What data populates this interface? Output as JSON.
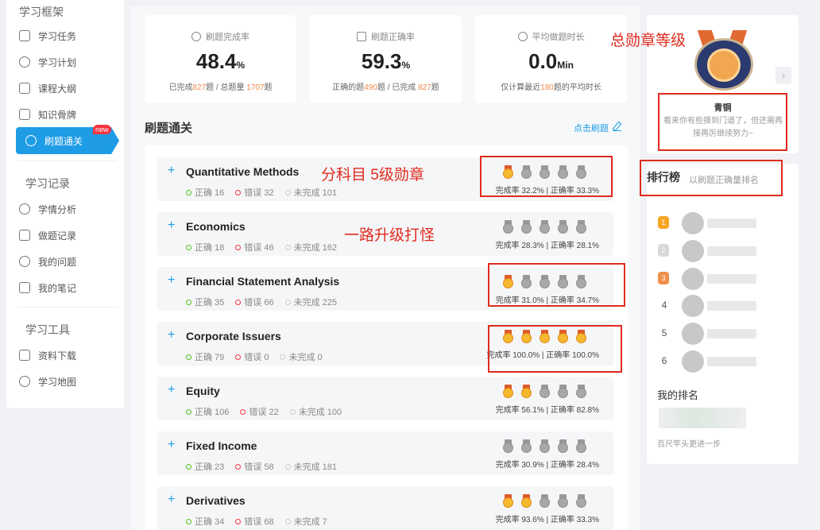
{
  "sidebar": {
    "section_framework": "学习框架",
    "items_framework": [
      {
        "label": "学习任务"
      },
      {
        "label": "学习计划"
      },
      {
        "label": "课程大纲"
      },
      {
        "label": "知识骨牌"
      },
      {
        "label": "刷题通关",
        "badge": "new"
      }
    ],
    "section_records": "学习记录",
    "items_records": [
      {
        "label": "学情分析"
      },
      {
        "label": "做题记录"
      },
      {
        "label": "我的问题"
      },
      {
        "label": "我的笔记"
      }
    ],
    "section_tools": "学习工具",
    "items_tools": [
      {
        "label": "资料下载"
      },
      {
        "label": "学习地图"
      }
    ]
  },
  "stats": [
    {
      "title": "刷题完成率",
      "value": "48.4",
      "unit": "%",
      "sub_a": "已完成",
      "sub_a_num": "827",
      "sub_b": "题 / 总题量 ",
      "sub_b_num": "1707",
      "sub_c": "题"
    },
    {
      "title": "刷题正确率",
      "value": "59.3",
      "unit": "%",
      "sub_a": "正确的题",
      "sub_a_num": "490",
      "sub_b": "题 / 已完成 ",
      "sub_b_num": "827",
      "sub_c": "题"
    },
    {
      "title": "平均做题时长",
      "value": "0.0",
      "unit": "Min",
      "sub_a": "仅计算最近",
      "sub_a_num": "180",
      "sub_b": "题的平均时长",
      "sub_b_num": "",
      "sub_c": ""
    }
  ],
  "section": {
    "title": "刷题通关",
    "link": "点击刷题"
  },
  "subjects": [
    {
      "name": "Quantitative Methods",
      "correct": "正确 16",
      "wrong": "错误 32",
      "todo": "未完成 101",
      "gold_medals": 1,
      "rate": "完成率 32.2% | 正确率 33.3%"
    },
    {
      "name": "Economics",
      "correct": "正确 18",
      "wrong": "错误 46",
      "todo": "未完成 162",
      "gold_medals": 0,
      "rate": "完成率 28.3% | 正确率 28.1%"
    },
    {
      "name": "Financial Statement Analysis",
      "correct": "正确 35",
      "wrong": "错误 66",
      "todo": "未完成 225",
      "gold_medals": 1,
      "rate": "完成率 31.0% | 正确率 34.7%"
    },
    {
      "name": "Corporate Issuers",
      "correct": "正确 79",
      "wrong": "错误 0",
      "todo": "未完成 0",
      "gold_medals": 5,
      "rate": "完成率 100.0% | 正确率 100.0%"
    },
    {
      "name": "Equity",
      "correct": "正确 106",
      "wrong": "错误 22",
      "todo": "未完成 100",
      "gold_medals": 2,
      "rate": "完成率 56.1% | 正确率 82.8%"
    },
    {
      "name": "Fixed Income",
      "correct": "正确 23",
      "wrong": "错误 58",
      "todo": "未完成 181",
      "gold_medals": 0,
      "rate": "完成率 30.9% | 正确率 28.4%"
    },
    {
      "name": "Derivatives",
      "correct": "正确 34",
      "wrong": "错误 68",
      "todo": "未完成 7",
      "gold_medals": 2,
      "rate": "完成率 93.6% | 正确率 33.3%"
    }
  ],
  "badge": {
    "name": "青铜",
    "desc": "看来你有些摸到门道了，但还需再接再厉继续努力~"
  },
  "ranking": {
    "title": "排行榜",
    "sub": "以刷题正确量排名",
    "rows": [
      {
        "num": "1"
      },
      {
        "num": "2"
      },
      {
        "num": "3"
      },
      {
        "num": "4"
      },
      {
        "num": "5"
      },
      {
        "num": "6"
      }
    ],
    "my_rank": "我的排名",
    "hint": "百尺竿头更进一步"
  },
  "annotations": {
    "total_badge": "总勋章等级",
    "per_subject": "分科目  5级勋章",
    "upgrade": "一路升级打怪"
  },
  "colors": {
    "accent": "#1e9ce6",
    "highlight": "#f08a4b",
    "annotation": "#e02b1e"
  }
}
